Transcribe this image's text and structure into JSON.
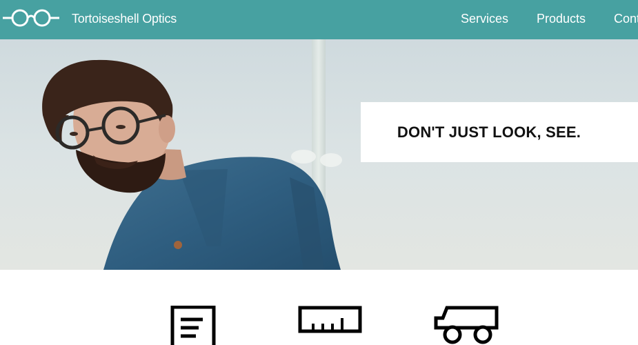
{
  "header": {
    "brand_name": "Tortoiseshell Optics",
    "logo_icon": "glasses-icon",
    "nav": [
      {
        "label": "Services"
      },
      {
        "label": "Products"
      },
      {
        "label": "Cont"
      }
    ]
  },
  "hero": {
    "image": "man-with-glasses-photo",
    "tagline": "DON'T JUST LOOK, SEE."
  },
  "features": {
    "icons": [
      "document-icon",
      "ruler-icon",
      "truck-icon"
    ]
  },
  "colors": {
    "header_bg": "#47a1a1",
    "header_text": "#ffffff",
    "tagline_text": "#111111"
  }
}
